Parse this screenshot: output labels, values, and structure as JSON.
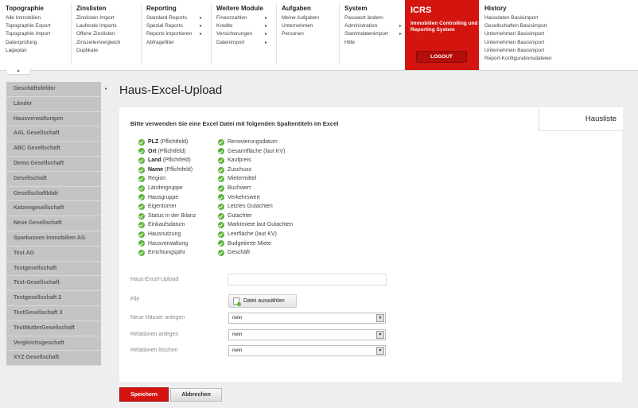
{
  "nav": {
    "columns": [
      {
        "title": "Topographie",
        "items": [
          "Alle Immobilien",
          "Topographie Export",
          "Topographie Import",
          "Datenprüfung",
          "Lageplan"
        ],
        "arrows": []
      },
      {
        "title": "Zinslisten",
        "items": [
          "Zinslisten Import",
          "Laufende Imports",
          "Offene Zinslisten",
          "Zinszeilenvergleich",
          "Duplikate"
        ],
        "arrows": []
      },
      {
        "title": "Reporting",
        "items": [
          "Standard Reports",
          "Spezial Reports",
          "Reports importieren",
          "Abfragefilter"
        ],
        "arrows": [
          0,
          1,
          2
        ]
      },
      {
        "title": "Weitere Module",
        "items": [
          "Finanzzahlen",
          "Kredite",
          "Versicherungen",
          "Datenimport"
        ],
        "arrows": [
          0,
          1,
          2,
          3
        ]
      },
      {
        "title": "Aufgaben",
        "items": [
          "Meine Aufgaben",
          "Unternehmen",
          "Personen"
        ],
        "arrows": []
      },
      {
        "title": "System",
        "items": [
          "Passwort ändern",
          "Administration",
          "Stammdatenimport",
          "Hilfe"
        ],
        "arrows": [
          1,
          2
        ]
      },
      {
        "title": "History",
        "items": [
          "Hausdaten Basisimport",
          "Gesellschaften Basisimport",
          "Unternehmen Basisimport",
          "Unternehmen Basisimport",
          "Unternehmen Basisimport",
          "Report-Konfigurationsdateien"
        ],
        "arrows": []
      }
    ],
    "arrow_glyph": "▸"
  },
  "brand": {
    "title": "ICRS",
    "subtitle": "Immobilien Controlling und Reporting System",
    "logout": "LOGOUT",
    "color": "#d3140f"
  },
  "sidebar": {
    "items": [
      "Geschäftsfelder",
      "Länder",
      "Hausverwaltungen",
      "AAL Gesellschaft",
      "ABC Gesellschaft",
      "Demo Gesellschaft",
      "Gesellschaft",
      "Gesellschaftblah",
      "Katzengesellschaft",
      "Neue Gesellschaft",
      "Sparkassen Immobilien AG",
      "Test AG",
      "Testgesellschaft",
      "Test-Gesellschaft",
      "Testgesellschaft 2",
      "TestGesellschaft 3",
      "TestMutterGesellschaft",
      "Vergleichsgeschaft",
      "XYZ Gesellschaft"
    ]
  },
  "page": {
    "title": "Haus-Excel-Upload",
    "tab": "Hausliste",
    "instruction": "Bitte verwenden Sie eine Excel Datei mit folgenden Spaltentiteln im Excel"
  },
  "columns_left": [
    {
      "name": "PLZ",
      "note": "(Pflichtfeld)"
    },
    {
      "name": "Ort",
      "note": "(Pflichtfeld)"
    },
    {
      "name": "Land",
      "note": "(Pflichtfeld)"
    },
    {
      "name": "Name",
      "note": "(Pflichtfeld)"
    },
    {
      "name": "",
      "note": "Region"
    },
    {
      "name": "",
      "note": "Ländergruppe"
    },
    {
      "name": "",
      "note": "Hausgruppe"
    },
    {
      "name": "",
      "note": "Eigentümer"
    },
    {
      "name": "",
      "note": "Status in der Bilanz"
    },
    {
      "name": "",
      "note": "Einkaufsdatum"
    },
    {
      "name": "",
      "note": "Hausnutzung"
    },
    {
      "name": "",
      "note": "Hausverwaltung"
    },
    {
      "name": "",
      "note": "Errichtungsjahr"
    }
  ],
  "columns_right": [
    "Renovierungsdatum",
    "Gesamtfläche (laut KV)",
    "Kaufpreis",
    "Zuschuss",
    "Mietermittel",
    "Buchwert",
    "Verkehrswert",
    "Letztes Gutachten",
    "Gutachter",
    "Marktmiete laut Gutachten",
    "Leerfläche (laut KV)",
    "Budgetierte Miete",
    "Geschäft"
  ],
  "form": {
    "upload_label": "Haus-Excel-Upload",
    "file_label": "File",
    "file_button": "Datei auswählen",
    "neue_label": "Neue Häuser anlegen",
    "neue_value": "nein",
    "rel_anlegen_label": "Relationen anlegen",
    "rel_anlegen_value": "nein",
    "rel_loeschen_label": "Relationen löschen",
    "rel_loeschen_value": "nein"
  },
  "actions": {
    "save": "Speichern",
    "cancel": "Abbrechen"
  }
}
